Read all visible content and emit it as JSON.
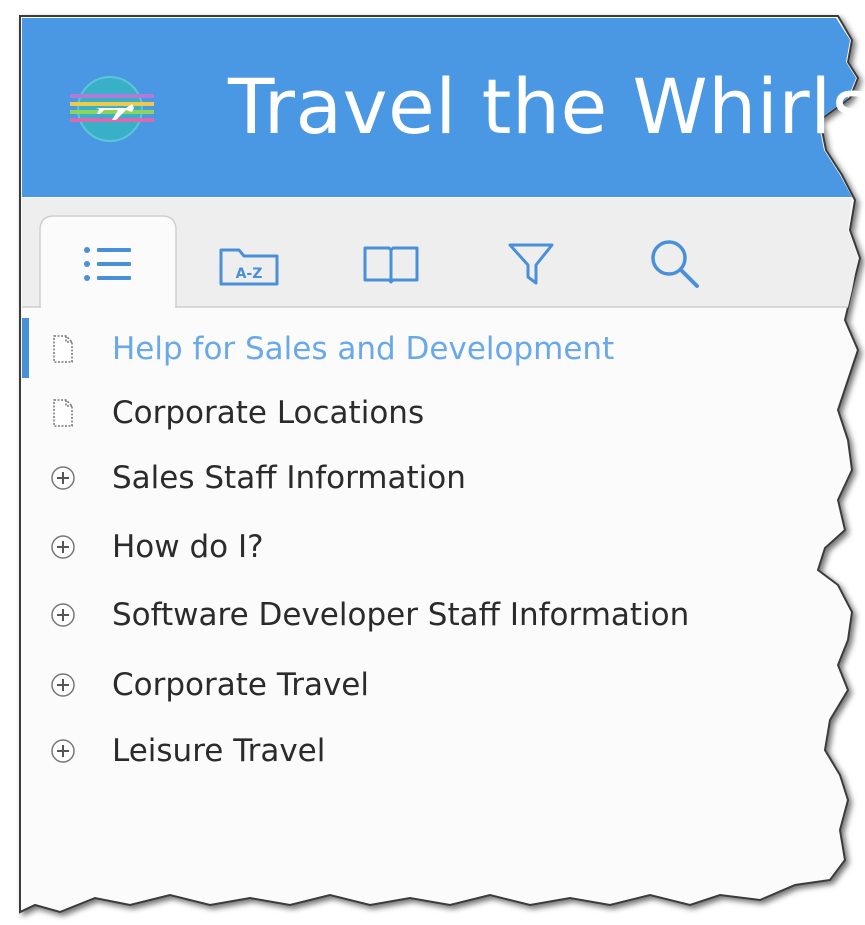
{
  "header": {
    "title": "Travel the Whirls",
    "logo_icon": "airplane-globe-icon",
    "background_color": "#4a97e3",
    "title_color": "#ffffff"
  },
  "tabs": [
    {
      "name": "contents",
      "icon": "list-icon",
      "active": true
    },
    {
      "name": "index",
      "icon": "a-z-folder-icon",
      "label": "A-Z",
      "active": false
    },
    {
      "name": "glossary",
      "icon": "open-book-icon",
      "active": false
    },
    {
      "name": "filter",
      "icon": "filter-icon",
      "active": false
    },
    {
      "name": "search",
      "icon": "search-icon",
      "active": false
    }
  ],
  "toc": {
    "accent_color": "#4a90d9",
    "items": [
      {
        "label": "Help for Sales and Development",
        "icon": "page-icon",
        "active": true
      },
      {
        "label": "Corporate Locations",
        "icon": "page-icon",
        "active": false
      },
      {
        "label": "Sales Staff Information",
        "icon": "expand-plus-icon",
        "active": false
      },
      {
        "label": "How do I?",
        "icon": "expand-plus-icon",
        "active": false
      },
      {
        "label": "Software Developer Staff Information",
        "icon": "expand-plus-icon",
        "active": false
      },
      {
        "label": "Corporate Travel",
        "icon": "expand-plus-icon",
        "active": false
      },
      {
        "label": "Leisure Travel",
        "icon": "expand-plus-icon",
        "active": false
      }
    ]
  }
}
